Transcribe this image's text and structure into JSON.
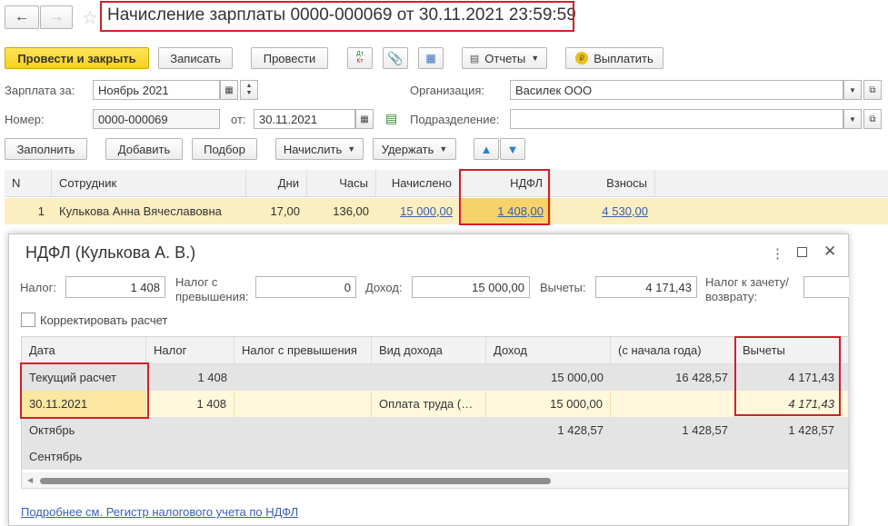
{
  "window": {
    "title": "Начисление зарплаты 0000-000069 от 30.11.2021 23:59:59"
  },
  "toolbar": {
    "post_close": "Провести и закрыть",
    "save": "Записать",
    "post": "Провести",
    "dtkt": "Дт Кт",
    "reports": "Отчеты",
    "pay": "Выплатить"
  },
  "form": {
    "salary_for_label": "Зарплата за:",
    "salary_for_value": "Ноябрь 2021",
    "org_label": "Организация:",
    "org_value": "Василек ООО",
    "number_label": "Номер:",
    "number_value": "0000-000069",
    "from_label": "от:",
    "from_value": "30.11.2021",
    "dept_label": "Подразделение:",
    "dept_value": ""
  },
  "actions": {
    "fill": "Заполнить",
    "add": "Добавить",
    "pick": "Подбор",
    "accrue": "Начислить",
    "withhold": "Удержать"
  },
  "main_table": {
    "columns": [
      "N",
      "Сотрудник",
      "Дни",
      "Часы",
      "Начислено",
      "НДФЛ",
      "Взносы"
    ],
    "rows": [
      {
        "n": "1",
        "employee": "Кулькова Анна Вячеславовна",
        "days": "17,00",
        "hours": "136,00",
        "accrued": "15 000,00",
        "ndfl": "1 408,00",
        "contrib": "4 530,00"
      }
    ]
  },
  "dialog": {
    "title": "НДФЛ (Кулькова А. В.)",
    "tax_label": "Налог:",
    "tax_value": "1 408",
    "excess_label_1": "Налог с",
    "excess_label_2": "превышения:",
    "excess_value": "0",
    "income_label": "Доход:",
    "income_value": "15 000,00",
    "deductions_label": "Вычеты:",
    "deductions_value": "4 171,43",
    "offset_label_1": "Налог к зачету/",
    "offset_label_2": "возврату:",
    "offset_value": "",
    "correct_label": "Корректировать расчет",
    "columns": [
      "Дата",
      "Налог",
      "Налог с превышения",
      "Вид дохода",
      "Доход",
      "(с начала года)",
      "Вычеты"
    ],
    "rows": [
      {
        "date": "Текущий расчет",
        "tax": "1 408",
        "excess": "",
        "kind": "",
        "income": "15 000,00",
        "ytd": "16 428,57",
        "deductions": "4 171,43"
      },
      {
        "date": "30.11.2021",
        "tax": "1 408",
        "excess": "",
        "kind": "Оплата труда (…",
        "income": "15 000,00",
        "ytd": "",
        "deductions": "4 171,43"
      },
      {
        "date": "Октябрь",
        "tax": "",
        "excess": "",
        "kind": "",
        "income": "1 428,57",
        "ytd": "1 428,57",
        "deductions": "1 428,57"
      },
      {
        "date": "Сентябрь",
        "tax": "",
        "excess": "",
        "kind": "",
        "income": "",
        "ytd": "",
        "deductions": ""
      }
    ],
    "footer_link": "Подробнее см. Регистр налогового учета по НДФЛ"
  }
}
